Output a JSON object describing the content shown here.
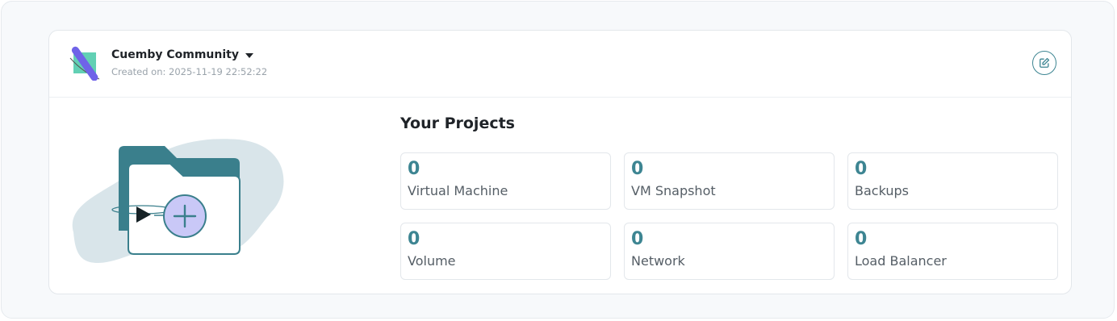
{
  "organization": {
    "name": "Cuemby Community",
    "created_label": "Created on: 2025-11-19 22:52:22"
  },
  "header": {
    "edit_icon": "edit-icon"
  },
  "projects": {
    "title": "Your Projects",
    "stats": [
      {
        "value": "0",
        "label": "Virtual Machine"
      },
      {
        "value": "0",
        "label": "VM Snapshot"
      },
      {
        "value": "0",
        "label": "Backups"
      },
      {
        "value": "0",
        "label": "Volume"
      },
      {
        "value": "0",
        "label": "Network"
      },
      {
        "value": "0",
        "label": "Load Balancer"
      }
    ]
  },
  "colors": {
    "accent": "#3d8592",
    "folder": "#3a7f8c",
    "blob": "#d9e5ea",
    "plus_circle": "#c9c8f7"
  }
}
